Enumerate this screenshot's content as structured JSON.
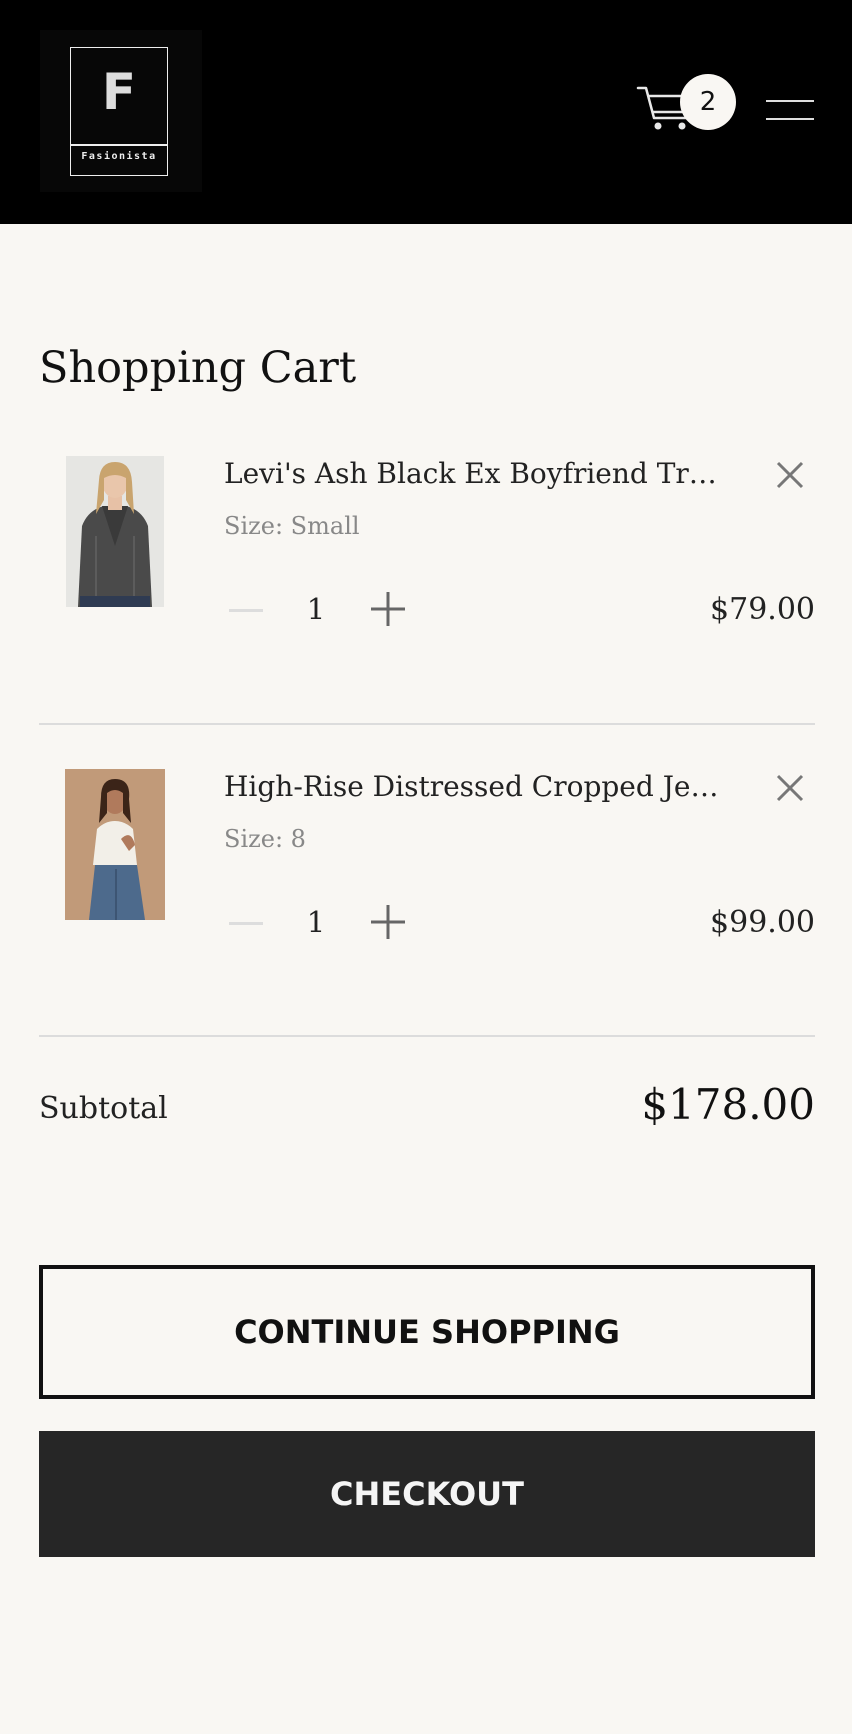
{
  "header": {
    "logo_letter": "F",
    "logo_name": "Fasionista",
    "cart_count": "2"
  },
  "page_title": "Shopping Cart",
  "items": [
    {
      "name": "Levi's Ash Black Ex Boyfriend Trucker Jacket",
      "size": "Size: Small",
      "quantity": "1",
      "price": "$79.00",
      "image": "model wearing grey denim jacket"
    },
    {
      "name": "High-Rise Distressed Cropped Jeans",
      "size": "Size: 8",
      "quantity": "1",
      "price": "$99.00",
      "image": "model wearing white tee and blue jeans"
    }
  ],
  "subtotal": {
    "label": "Subtotal",
    "value": "$178.00"
  },
  "buttons": {
    "continue": "CONTINUE SHOPPING",
    "checkout": "CHECKOUT"
  }
}
